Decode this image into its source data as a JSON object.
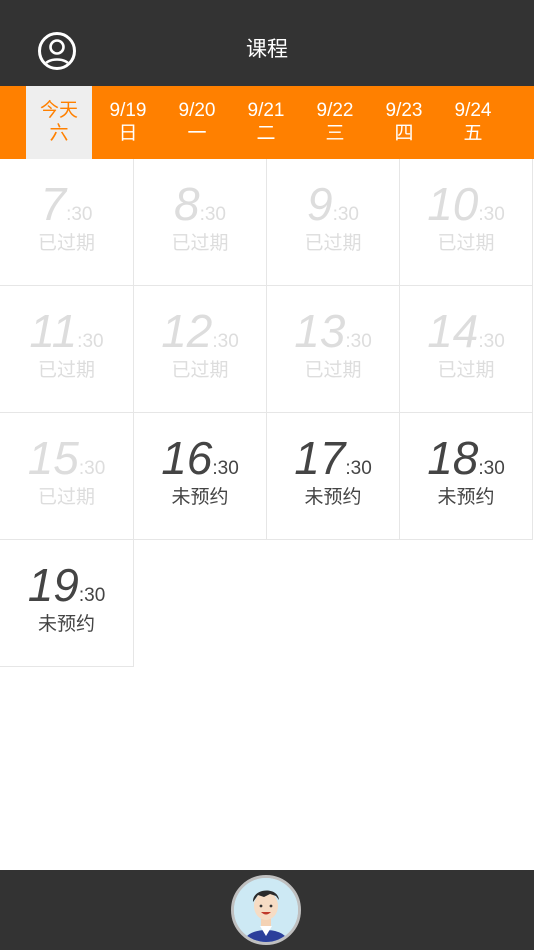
{
  "header": {
    "title": "课程",
    "profile_icon": "user-icon"
  },
  "date_tabs": [
    {
      "date": "今天",
      "weekday": "六",
      "active": true
    },
    {
      "date": "9/19",
      "weekday": "日",
      "active": false
    },
    {
      "date": "9/20",
      "weekday": "一",
      "active": false
    },
    {
      "date": "9/21",
      "weekday": "二",
      "active": false
    },
    {
      "date": "9/22",
      "weekday": "三",
      "active": false
    },
    {
      "date": "9/23",
      "weekday": "四",
      "active": false
    },
    {
      "date": "9/24",
      "weekday": "五",
      "active": false
    }
  ],
  "slots": [
    {
      "hour": "7",
      "minute": ":30",
      "status": "已过期",
      "expired": true
    },
    {
      "hour": "8",
      "minute": ":30",
      "status": "已过期",
      "expired": true
    },
    {
      "hour": "9",
      "minute": ":30",
      "status": "已过期",
      "expired": true
    },
    {
      "hour": "10",
      "minute": ":30",
      "status": "已过期",
      "expired": true
    },
    {
      "hour": "11",
      "minute": ":30",
      "status": "已过期",
      "expired": true
    },
    {
      "hour": "12",
      "minute": ":30",
      "status": "已过期",
      "expired": true
    },
    {
      "hour": "13",
      "minute": ":30",
      "status": "已过期",
      "expired": true
    },
    {
      "hour": "14",
      "minute": ":30",
      "status": "已过期",
      "expired": true
    },
    {
      "hour": "15",
      "minute": ":30",
      "status": "已过期",
      "expired": true
    },
    {
      "hour": "16",
      "minute": ":30",
      "status": "未预约",
      "expired": false
    },
    {
      "hour": "17",
      "minute": ":30",
      "status": "未预约",
      "expired": false
    },
    {
      "hour": "18",
      "minute": ":30",
      "status": "未预约",
      "expired": false
    },
    {
      "hour": "19",
      "minute": ":30",
      "status": "未预约",
      "expired": false
    }
  ],
  "bottom_bar": {
    "avatar_icon": "coach-avatar-icon"
  },
  "colors": {
    "header_bg": "#333333",
    "accent": "#ff8000",
    "active_tab_bg": "#eeeeee",
    "expired_text": "#dddddd",
    "available_text": "#444444"
  }
}
